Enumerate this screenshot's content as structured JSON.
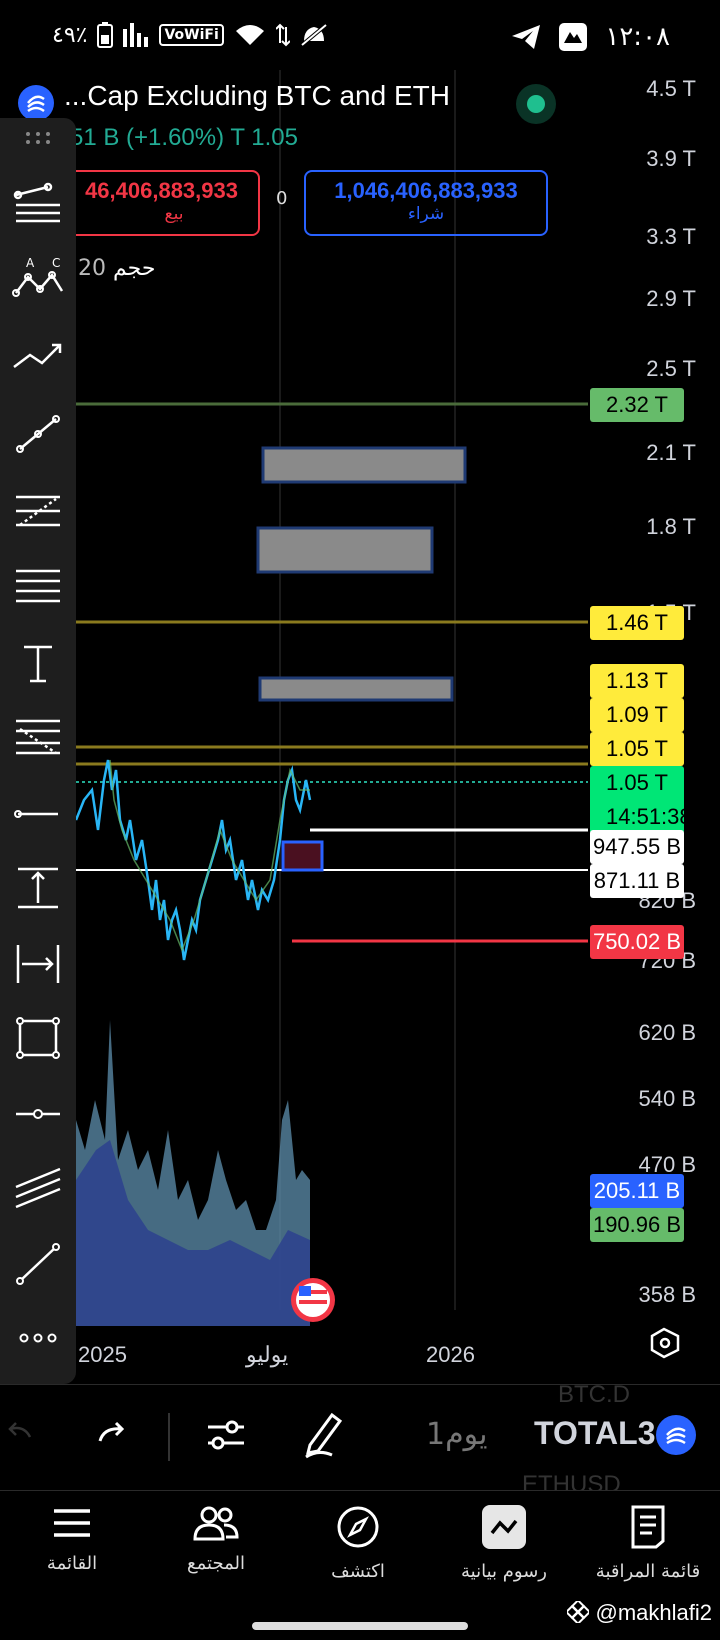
{
  "status_bar": {
    "battery_percent": "٤٩٪",
    "wifi_label": "VoWiFi",
    "time": "١٢:٠٨"
  },
  "header": {
    "title": "...Cap Excluding BTC and ETH",
    "price_change": "51 B (+1.60%)  T 1.05",
    "sell_price": "46,406,883,933",
    "sell_label": "بيع",
    "spread": "0",
    "buy_price": "1,046,406,883,933",
    "buy_label": "شراء",
    "volume_label": "حجم",
    "volume_value": "20"
  },
  "toolbar": {
    "tools": [
      "trend-lines-icon",
      "patterns-icon",
      "projection-icon",
      "line-icon",
      "fib-icon",
      "horizontal-lines-icon",
      "text-icon",
      "gann-icon",
      "horizontal-ray-icon",
      "measure-icon",
      "date-range-icon",
      "rectangle-icon",
      "node-icon",
      "parallel-channel-icon",
      "segment-icon",
      "more-icon"
    ]
  },
  "price_axis": {
    "labels": [
      "4.5 T",
      "3.9 T",
      "3.3 T",
      "2.9 T",
      "2.5 T",
      "2.1 T",
      "1.8 T",
      "1.5 T",
      "820 B",
      "720 B",
      "620 B",
      "540 B",
      "470 B",
      "358 B"
    ]
  },
  "price_tags": [
    {
      "text": "2.32 T",
      "bg": "#66bb6a",
      "fg": "#000"
    },
    {
      "text": "1.46 T",
      "bg": "#ffeb3b",
      "fg": "#000"
    },
    {
      "text": "1.13 T",
      "bg": "#ffeb3b",
      "fg": "#000"
    },
    {
      "text": "1.09 T",
      "bg": "#ffeb3b",
      "fg": "#000"
    },
    {
      "text": "1.05 T",
      "bg": "#ffeb3b",
      "fg": "#000"
    },
    {
      "text": "1.05 T",
      "bg": "#00e676",
      "fg": "#000"
    },
    {
      "text": "14:51:38",
      "bg": "#00e676",
      "fg": "#000"
    },
    {
      "text": "947.55 B",
      "bg": "#ffffff",
      "fg": "#000"
    },
    {
      "text": "871.11 B",
      "bg": "#ffffff",
      "fg": "#000"
    },
    {
      "text": "750.02 B",
      "bg": "#f23645",
      "fg": "#fff"
    },
    {
      "text": "205.11 B",
      "bg": "#2962ff",
      "fg": "#fff"
    },
    {
      "text": "190.96 B",
      "bg": "#66bb6a",
      "fg": "#000"
    }
  ],
  "time_axis": {
    "labels": [
      "2025",
      "يوليو",
      "2026"
    ]
  },
  "symbol_bar": {
    "symbol": "TOTAL3",
    "interval": "1يوم",
    "ghost_top": "BTC.D",
    "ghost_bottom": "ETHUSD"
  },
  "nav": {
    "items": [
      {
        "label": "القائمة",
        "icon": "menu-icon"
      },
      {
        "label": "المجتمع",
        "icon": "community-icon"
      },
      {
        "label": "اكتشف",
        "icon": "explore-icon"
      },
      {
        "label": "رسوم بيانية",
        "icon": "charts-icon"
      },
      {
        "label": "قائمة المراقبة",
        "icon": "watchlist-icon"
      }
    ]
  },
  "watermark": "@makhlafi2",
  "colors": {
    "accent": "#2962ff",
    "up": "#22ab94",
    "down": "#f23645",
    "zone": "#888888",
    "level_yellow": "#b8a22a"
  }
}
